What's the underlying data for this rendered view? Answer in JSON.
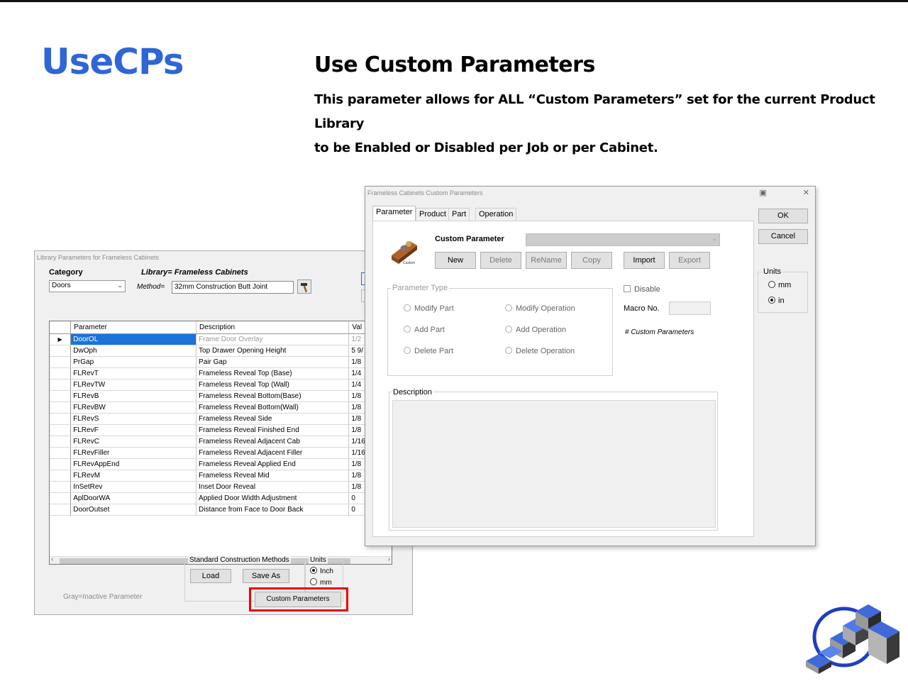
{
  "slide": {
    "title": "UseCPs",
    "heading": "Use Custom Parameters",
    "description_line1": "This parameter allows for ALL “Custom Parameters” set for the current Product Library",
    "description_line2": "to be Enabled or Disabled per Job or per Cabinet."
  },
  "colors": {
    "title_blue": "#2f66d6",
    "selection_blue": "#1a73d9",
    "highlight_red": "#e00000"
  },
  "library_window": {
    "title": "Library Parameters for Frameless Cabinets",
    "category_label": "Category",
    "category_value": "Doors",
    "library_label": "Library= Frameless Cabinets",
    "method_label": "Method=",
    "method_value": "32mm Construction Butt Joint",
    "columns": [
      "Parameter",
      "Description",
      "Val"
    ],
    "rows": [
      {
        "param": "DoorOL",
        "desc": "Frame Door Overlay",
        "val": "1/2"
      },
      {
        "param": "DwOph",
        "desc": "Top Drawer Opening Height",
        "val": "5 9/"
      },
      {
        "param": "PrGap",
        "desc": "Pair Gap",
        "val": "1/8"
      },
      {
        "param": "FLRevT",
        "desc": "Frameless Reveal Top (Base)",
        "val": "1/4"
      },
      {
        "param": "FLRevTW",
        "desc": "Frameless Reveal Top (Wall)",
        "val": "1/4"
      },
      {
        "param": "FLRevB",
        "desc": "Frameless Reveal Bottom(Base)",
        "val": "1/8"
      },
      {
        "param": "FLRevBW",
        "desc": "Frameless Reveal Bottom(Wall)",
        "val": "1/8"
      },
      {
        "param": "FLRevS",
        "desc": "Frameless Reveal Side",
        "val": "1/8"
      },
      {
        "param": "FLRevF",
        "desc": "Frameless Reveal Finished End",
        "val": "1/8"
      },
      {
        "param": "FLRevC",
        "desc": "Frameless Reveal Adjacent Cab",
        "val": "1/16"
      },
      {
        "param": "FLRevFiller",
        "desc": "Frameless Reveal Adjacent Filler",
        "val": "1/16"
      },
      {
        "param": "FLRevAppEnd",
        "desc": "Frameless Reveal Applied End",
        "val": "1/8"
      },
      {
        "param": "FLRevM",
        "desc": "Frameless Reveal Mid",
        "val": "1/8"
      },
      {
        "param": "InSetRev",
        "desc": "Inset Door Reveal",
        "val": "1/8"
      },
      {
        "param": "AplDoorWA",
        "desc": "Applied Door Width Adjustment",
        "val": "0"
      },
      {
        "param": "DoorOutset",
        "desc": "Distance from Face to Door Back",
        "val": "0"
      }
    ],
    "standard_methods_label": "Standard Construction Methods",
    "load_label": "Load",
    "save_as_label": "Save As",
    "units_label": "Units",
    "unit_inch": "Inch",
    "unit_mm": "mm",
    "gray_note": "Gray=Inactive Parameter",
    "custom_params_button": "Custom Parameters"
  },
  "cp_window": {
    "title": "Frameless Cabinets Custom Parameters",
    "tabs": [
      "Parameter",
      "Product",
      "Part",
      "Operation"
    ],
    "custom_parameter_label": "Custom Parameter",
    "plane_caption": "Custom",
    "buttons": {
      "new": "New",
      "delete": "Delete",
      "rename": "ReName",
      "copy": "Copy",
      "import": "Import",
      "export": "Export"
    },
    "parameter_type_label": "Parameter Type",
    "types": [
      "Modify Part",
      "Modify Operation",
      "Add Part",
      "Add Operation",
      "Delete Part",
      "Delete Operation"
    ],
    "disable_label": "Disable",
    "macro_label": "Macro No.",
    "count_label": "# Custom Parameters",
    "description_label": "Description",
    "ok_label": "OK",
    "cancel_label": "Cancel",
    "units_label": "Units",
    "unit_mm": "mm",
    "unit_in": "in"
  }
}
